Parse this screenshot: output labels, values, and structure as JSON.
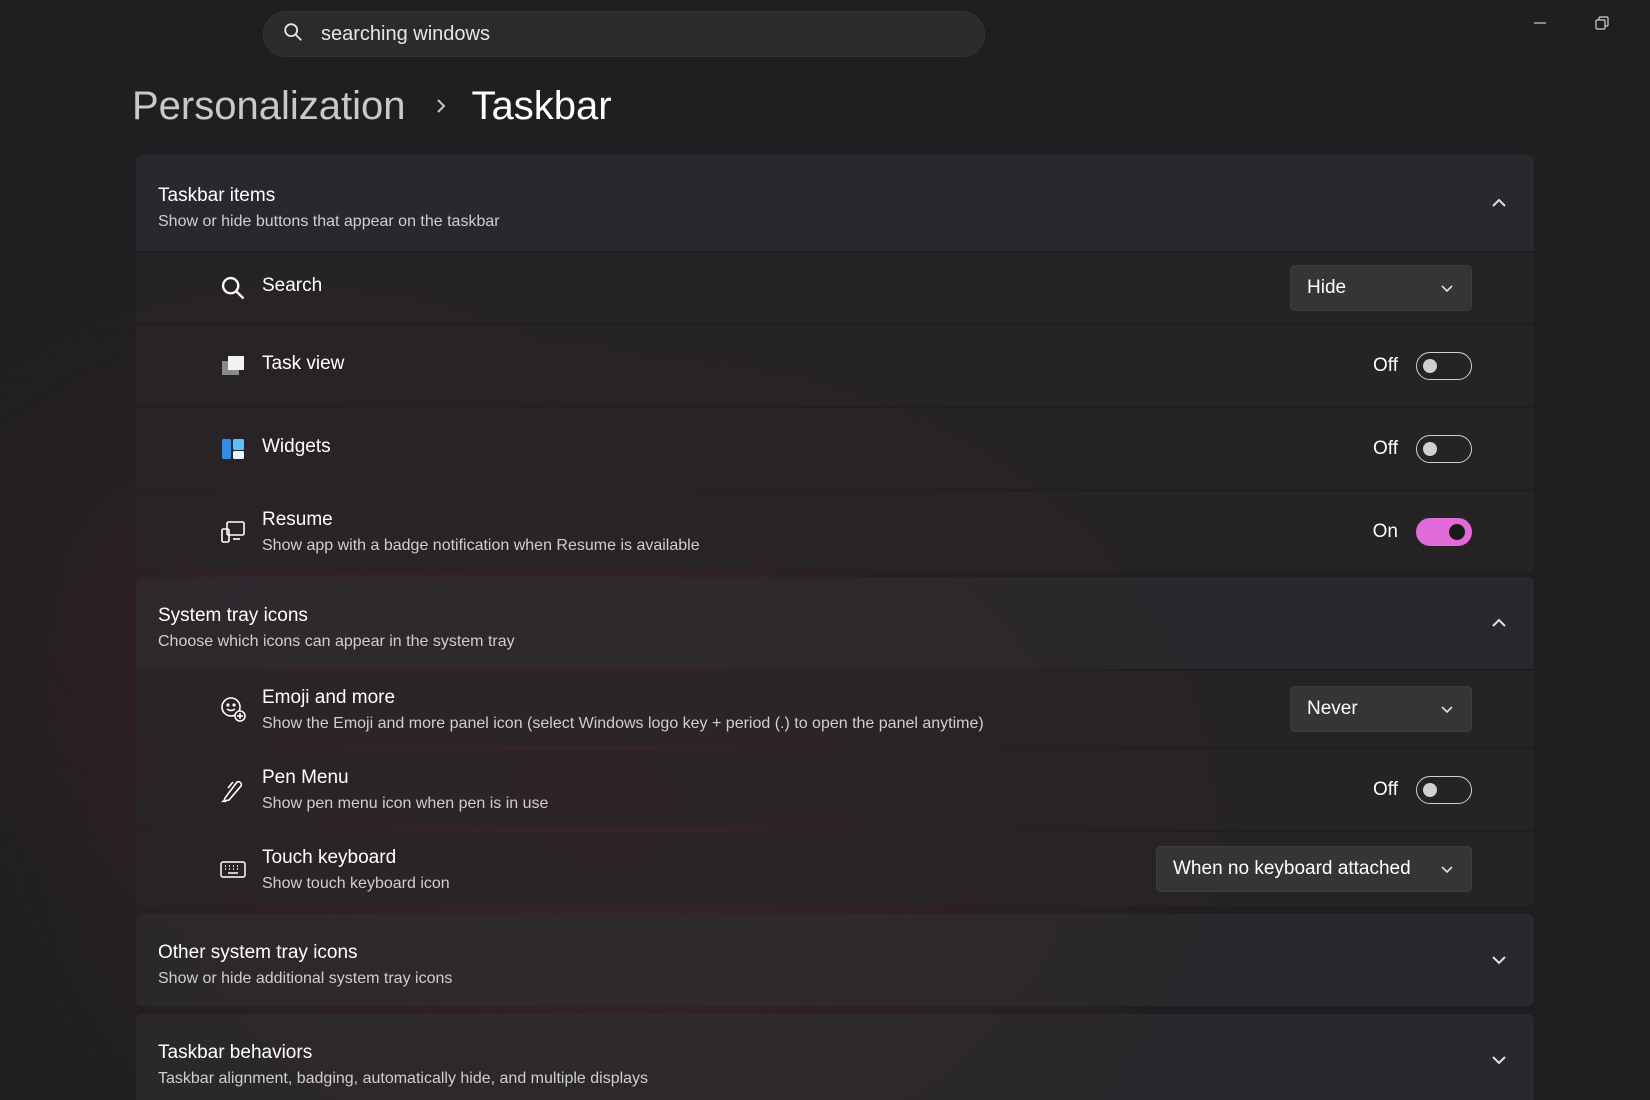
{
  "search": {
    "query": "searching windows",
    "icon": "search-icon"
  },
  "window_controls": {
    "minimize_icon": "minimize-icon",
    "restore_icon": "restore-icon"
  },
  "breadcrumb": {
    "parent": "Personalization",
    "separator_icon": "chevron-right-icon",
    "current": "Taskbar"
  },
  "colors": {
    "accent": "#e06ad8",
    "background": "#1f1f21",
    "card": "#2d2a2e"
  },
  "sections": {
    "taskbar_items": {
      "title": "Taskbar items",
      "subtitle": "Show or hide buttons that appear on the taskbar",
      "expanded": true,
      "rows": {
        "search": {
          "title": "Search",
          "control": "dropdown",
          "value": "Hide",
          "icon": "search-icon"
        },
        "task_view": {
          "title": "Task view",
          "control": "toggle",
          "state_label": "Off",
          "on": false,
          "icon": "task-view-icon"
        },
        "widgets": {
          "title": "Widgets",
          "control": "toggle",
          "state_label": "Off",
          "on": false,
          "icon": "widgets-icon"
        },
        "resume": {
          "title": "Resume",
          "subtitle": "Show app with a badge notification when Resume is available",
          "control": "toggle",
          "state_label": "On",
          "on": true,
          "icon": "resume-icon"
        }
      }
    },
    "system_tray": {
      "title": "System tray icons",
      "subtitle": "Choose which icons can appear in the system tray",
      "expanded": true,
      "rows": {
        "emoji": {
          "title": "Emoji and more",
          "subtitle": "Show the Emoji and more panel icon (select Windows logo key + period (.) to open the panel anytime)",
          "control": "dropdown",
          "value": "Never",
          "icon": "emoji-icon"
        },
        "pen_menu": {
          "title": "Pen Menu",
          "subtitle": "Show pen menu icon when pen is in use",
          "control": "toggle",
          "state_label": "Off",
          "on": false,
          "icon": "pen-icon"
        },
        "touch_keyboard": {
          "title": "Touch keyboard",
          "subtitle": "Show touch keyboard icon",
          "control": "dropdown",
          "value": "When no keyboard attached",
          "icon": "keyboard-icon"
        }
      }
    },
    "other_tray": {
      "title": "Other system tray icons",
      "subtitle": "Show or hide additional system tray icons",
      "expanded": false
    },
    "behaviors": {
      "title": "Taskbar behaviors",
      "subtitle": "Taskbar alignment, badging, automatically hide, and multiple displays",
      "expanded": false
    }
  }
}
